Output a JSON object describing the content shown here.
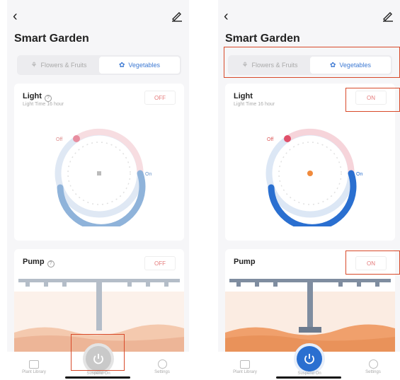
{
  "screens": [
    {
      "title": "Smart Garden",
      "tabs": [
        {
          "label": "Flowers & Fruits",
          "active": false
        },
        {
          "label": "Vegetables",
          "active": true
        }
      ],
      "light": {
        "title": "Light",
        "subtitle": "Light Time 16 hour",
        "switch_label": "OFF",
        "dial_off_label": "Off",
        "dial_on_label": "On"
      },
      "pump": {
        "title": "Pump",
        "switch_label": "OFF"
      },
      "nav": {
        "left": "Plant Library",
        "center": "Suspend On",
        "right": "Settings"
      }
    },
    {
      "title": "Smart Garden",
      "tabs": [
        {
          "label": "Flowers & Fruits",
          "active": false
        },
        {
          "label": "Vegetables",
          "active": true
        }
      ],
      "light": {
        "title": "Light",
        "subtitle": "Light Time 16 hour",
        "switch_label": "ON",
        "dial_off_label": "Off",
        "dial_on_label": "On"
      },
      "pump": {
        "title": "Pump",
        "switch_label": "ON"
      },
      "nav": {
        "left": "Plant Library",
        "center": "Suspend On",
        "right": "Settings"
      }
    }
  ],
  "colors": {
    "accent_blue": "#2a6fd0",
    "highlight": "#d84a2a",
    "soil": "#e9925a"
  }
}
